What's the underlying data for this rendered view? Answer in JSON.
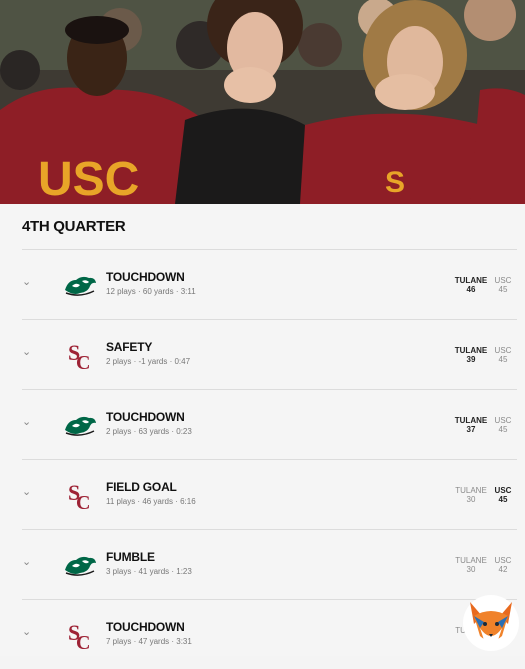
{
  "quarter_title": "4TH QUARTER",
  "teams": {
    "home": "TULANE",
    "away": "USC"
  },
  "colors": {
    "usc_red": "#9d2235",
    "tulane_green": "#006747",
    "text": "#111111",
    "muted": "#777777"
  },
  "plays": [
    {
      "team_icon": "tulane-wave-icon",
      "type": "TOUCHDOWN",
      "drive": "12 plays · 60 yards · 3:11",
      "tulane": "46",
      "usc": "45",
      "leader": "tulane"
    },
    {
      "team_icon": "usc-sc-icon",
      "type": "SAFETY",
      "drive": "2 plays · -1 yards · 0:47",
      "tulane": "39",
      "usc": "45",
      "leader": "tulane"
    },
    {
      "team_icon": "tulane-wave-icon",
      "type": "TOUCHDOWN",
      "drive": "2 plays · 63 yards · 0:23",
      "tulane": "37",
      "usc": "45",
      "leader": "tulane"
    },
    {
      "team_icon": "usc-sc-icon",
      "type": "FIELD GOAL",
      "drive": "11 plays · 46 yards · 6:16",
      "tulane": "30",
      "usc": "45",
      "leader": "usc"
    },
    {
      "team_icon": "tulane-wave-icon",
      "type": "FUMBLE",
      "drive": "3 plays · 41 yards · 1:23",
      "tulane": "30",
      "usc": "42",
      "leader": "none"
    },
    {
      "team_icon": "usc-sc-icon",
      "type": "TOUCHDOWN",
      "drive": "7 plays · 47 yards · 3:31",
      "tulane": "",
      "usc": "",
      "leader": "none"
    }
  ],
  "photo": {
    "jersey_text": "USC"
  }
}
